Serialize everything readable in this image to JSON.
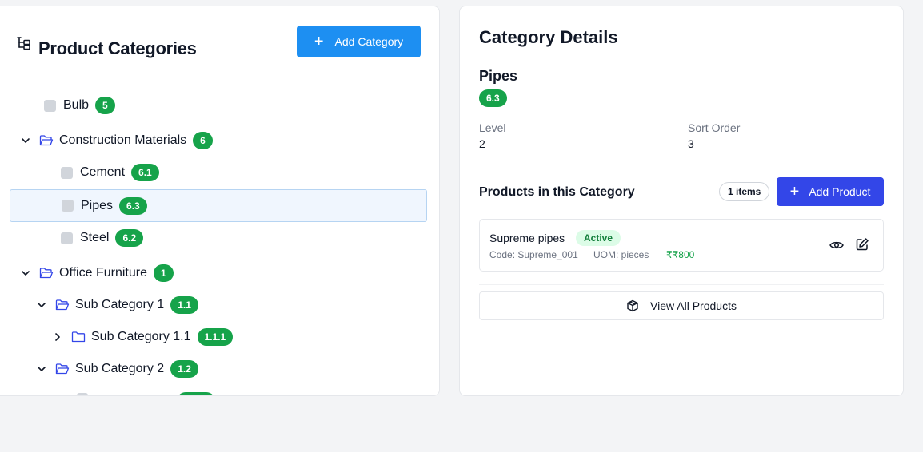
{
  "left_panel": {
    "title": "Product Categories",
    "title_icon": "tree-structure-icon",
    "add_button": "Add Category",
    "tree": [
      {
        "label": "Bulb",
        "badge": "5",
        "type": "leaf"
      },
      {
        "label": "Construction Materials",
        "badge": "6",
        "type": "folder",
        "expanded": true
      },
      {
        "label": "Cement",
        "badge": "6.1",
        "type": "leaf"
      },
      {
        "label": "Pipes",
        "badge": "6.3",
        "type": "leaf",
        "selected": true
      },
      {
        "label": "Steel",
        "badge": "6.2",
        "type": "leaf"
      },
      {
        "label": "Office Furniture",
        "badge": "1",
        "type": "folder",
        "expanded": true
      },
      {
        "label": "Sub Category 1",
        "badge": "1.1",
        "type": "folder",
        "expanded": true
      },
      {
        "label": "Sub Category 1.1",
        "badge": "1.1.1",
        "type": "folder",
        "expanded": false
      },
      {
        "label": "Sub Category 2",
        "badge": "1.2",
        "type": "folder",
        "expanded": true
      }
    ]
  },
  "right_panel": {
    "title": "Category Details",
    "category_name": "Pipes",
    "category_code": "6.3",
    "level_label": "Level",
    "level_value": "2",
    "sort_label": "Sort Order",
    "sort_value": "3",
    "products_title": "Products in this Category",
    "items_count": "1 items",
    "add_product": "Add Product",
    "products": [
      {
        "name": "Supreme pipes",
        "status": "Active",
        "code": "Code: Supreme_001",
        "uom": "UOM: pieces",
        "price": "₹₹800"
      }
    ],
    "view_all": "View All Products"
  },
  "colors": {
    "primary_blue": "#1d8ff2",
    "indigo": "#3346e8",
    "badge_green": "#16a34a",
    "folder_blue": "#3346e8",
    "selected_bg": "#f0f6fe"
  }
}
